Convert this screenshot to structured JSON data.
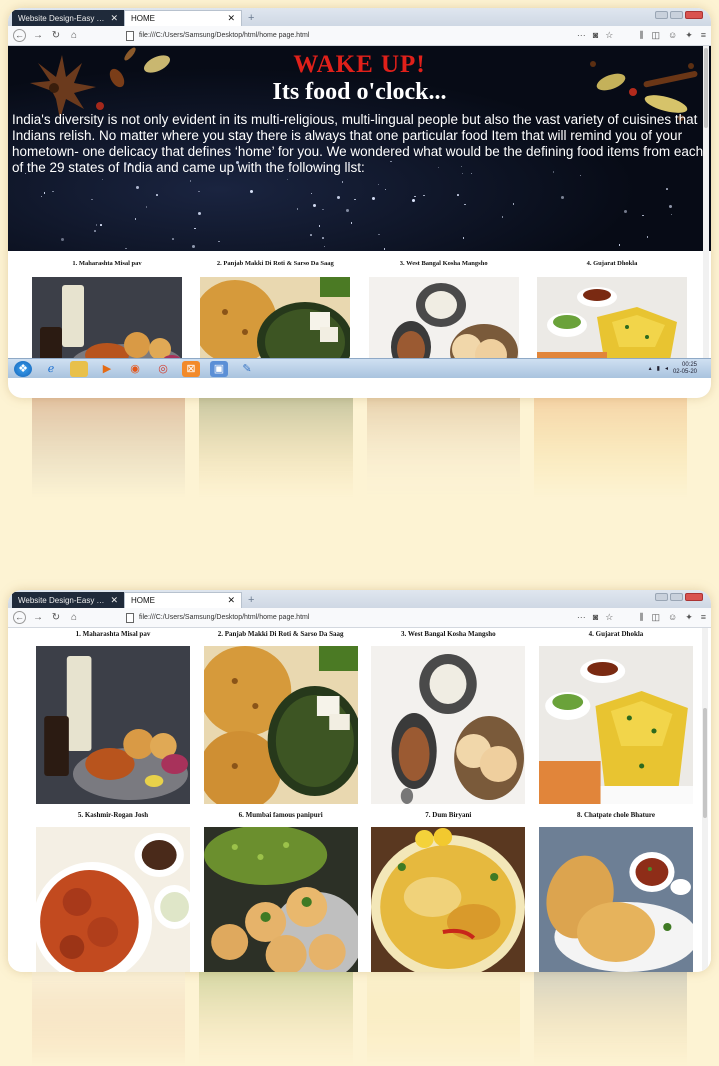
{
  "browser_top": {
    "tabs": [
      {
        "label": "Website Design-Easy Tutorial",
        "active": false
      },
      {
        "label": "HOME",
        "active": true
      }
    ],
    "url": "file:///C:/Users/Samsung/Desktop/html/home page.html"
  },
  "browser_bottom": {
    "tabs": [
      {
        "label": "Website Design-Easy Tutorial",
        "active": false
      },
      {
        "label": "HOME",
        "active": true
      }
    ],
    "url": "file:///C:/Users/Samsung/Desktop/html/home page.html"
  },
  "hero": {
    "title": "WAKE UP!",
    "subtitle": "Its food o'clock...",
    "intro": "India's diversity is not only evident in its multi-religious, multi-lingual people but also the vast variety of cuisines that Indians relish. No matter where you stay there is always that one particular food Item that will remind you of your hometown- one delicacy that defines ‘home’ for you. We wondered what would be the defining food items from each of the 29 states of India and came up with the following list:"
  },
  "foods_row1": [
    {
      "caption": "1. Maharashta Misal pav"
    },
    {
      "caption": "2. Panjab Makki Di Roti & Sarso Da Saag"
    },
    {
      "caption": "3. West Bangal Kosha Mangsho"
    },
    {
      "caption": "4. Gujarat Dhokla"
    }
  ],
  "foods_row2": [
    {
      "caption": "5. Kashmir-Rogan Josh"
    },
    {
      "caption": "6. Mumbai famous panipuri"
    },
    {
      "caption": "7. Dum Biryani"
    },
    {
      "caption": "8. Chatpate chole Bhature"
    }
  ],
  "taskbar": {
    "time": "00:25",
    "date": "02-05-20"
  },
  "colors": {
    "page_background": "#fdf3d3",
    "title_red": "#e0201a",
    "hero_background": "#070b16"
  }
}
